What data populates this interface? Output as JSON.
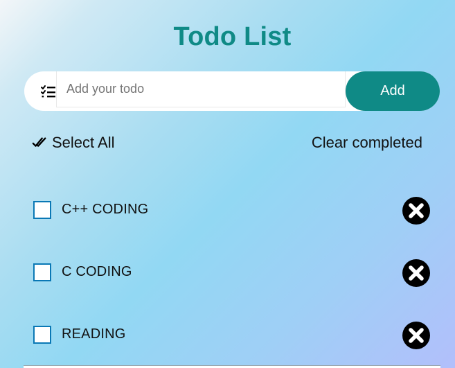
{
  "header": {
    "title": "Todo List"
  },
  "input": {
    "icon": "checklist-icon",
    "placeholder": "Add your todo",
    "value": ""
  },
  "add_button": {
    "label": "Add"
  },
  "controls": {
    "select_all_icon": "double-check-icon",
    "select_all_label": "Select All",
    "clear_completed_label": "Clear completed"
  },
  "todos": [
    {
      "text": "C++ CODING",
      "completed": false
    },
    {
      "text": "C CODING",
      "completed": false
    },
    {
      "text": "READING",
      "completed": false
    }
  ],
  "colors": {
    "accent": "#0f8a86",
    "checkbox_border": "#0a78b5",
    "delete_icon": "#000000"
  }
}
